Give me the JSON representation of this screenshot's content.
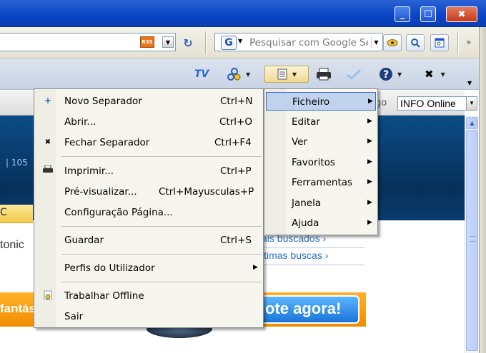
{
  "window": {
    "minimize_glyph": "_",
    "maximize_glyph": "☐",
    "close_glyph": "✖"
  },
  "addressbar": {
    "rss_badge": "RSS",
    "refresh_glyph": "↻",
    "dropdown_glyph": "▼"
  },
  "searchbar": {
    "logo_text": "G",
    "placeholder": "Pesquisar com Google Se",
    "chevron": "»"
  },
  "commandbar": {
    "tv_label": "TV",
    "dropdown_glyph": "▼",
    "close_glyph": "✖"
  },
  "linkbar": {
    "go_text": "go",
    "info_select_value": "INFO Online"
  },
  "page": {
    "number_text": "| 105",
    "yellow_tab_text": "C",
    "tonic_text": "tonic",
    "link_mais_buscados": "ais buscados ›",
    "link_ultimas_buscas": "ltimas buscas ›",
    "fantas_text": "fantás",
    "vote_button": "ote agora!"
  },
  "main_menu": {
    "items": [
      {
        "label": "Novo Separador",
        "shortcut": "Ctrl+N"
      },
      {
        "label": "Abrir...",
        "shortcut": "Ctrl+O"
      },
      {
        "label": "Fechar Separador",
        "shortcut": "Ctrl+F4"
      },
      {
        "label": "Imprimir...",
        "shortcut": "Ctrl+P"
      },
      {
        "label": "Pré-visualizar...",
        "shortcut": "Ctrl+Mayusculas+P"
      },
      {
        "label": "Configuração Página...",
        "shortcut": ""
      },
      {
        "label": "Guardar",
        "shortcut": "Ctrl+S"
      },
      {
        "label": "Perfis do Utilizador",
        "shortcut": ""
      },
      {
        "label": "Trabalhar Offline",
        "shortcut": ""
      },
      {
        "label": "Sair",
        "shortcut": ""
      }
    ],
    "submenu_arrow": "▶"
  },
  "page_menu": {
    "items": [
      {
        "label": "Ficheiro"
      },
      {
        "label": "Editar"
      },
      {
        "label": "Ver"
      },
      {
        "label": "Favoritos"
      },
      {
        "label": "Ferramentas"
      },
      {
        "label": "Janela"
      },
      {
        "label": "Ajuda"
      }
    ],
    "arrow": "▶"
  }
}
